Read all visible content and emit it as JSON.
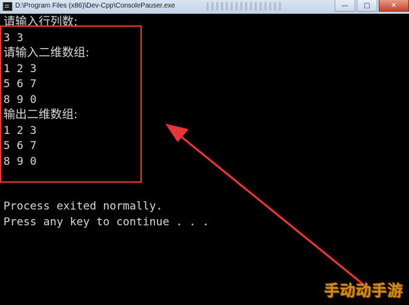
{
  "window": {
    "title": "D:\\Program Files (x86)\\Dev-Cpp\\ConsolePauser.exe",
    "minimize_label": "—",
    "maximize_label": "□",
    "close_label": "✕"
  },
  "console": {
    "lines": [
      "请输入行列数:",
      "3 3",
      "请输入二维数组:",
      "1 2 3",
      "5 6 7",
      "8 9 0",
      "输出二维数组:",
      "1 2 3",
      "5 6 7",
      "8 9 0"
    ],
    "status_lines": [
      "Process exited normally.",
      "Press any key to continue . . ."
    ]
  },
  "annotation": {
    "box_color": "#e8353a",
    "arrow_color": "#e8353a"
  },
  "watermark": {
    "text": "手动动手游"
  }
}
